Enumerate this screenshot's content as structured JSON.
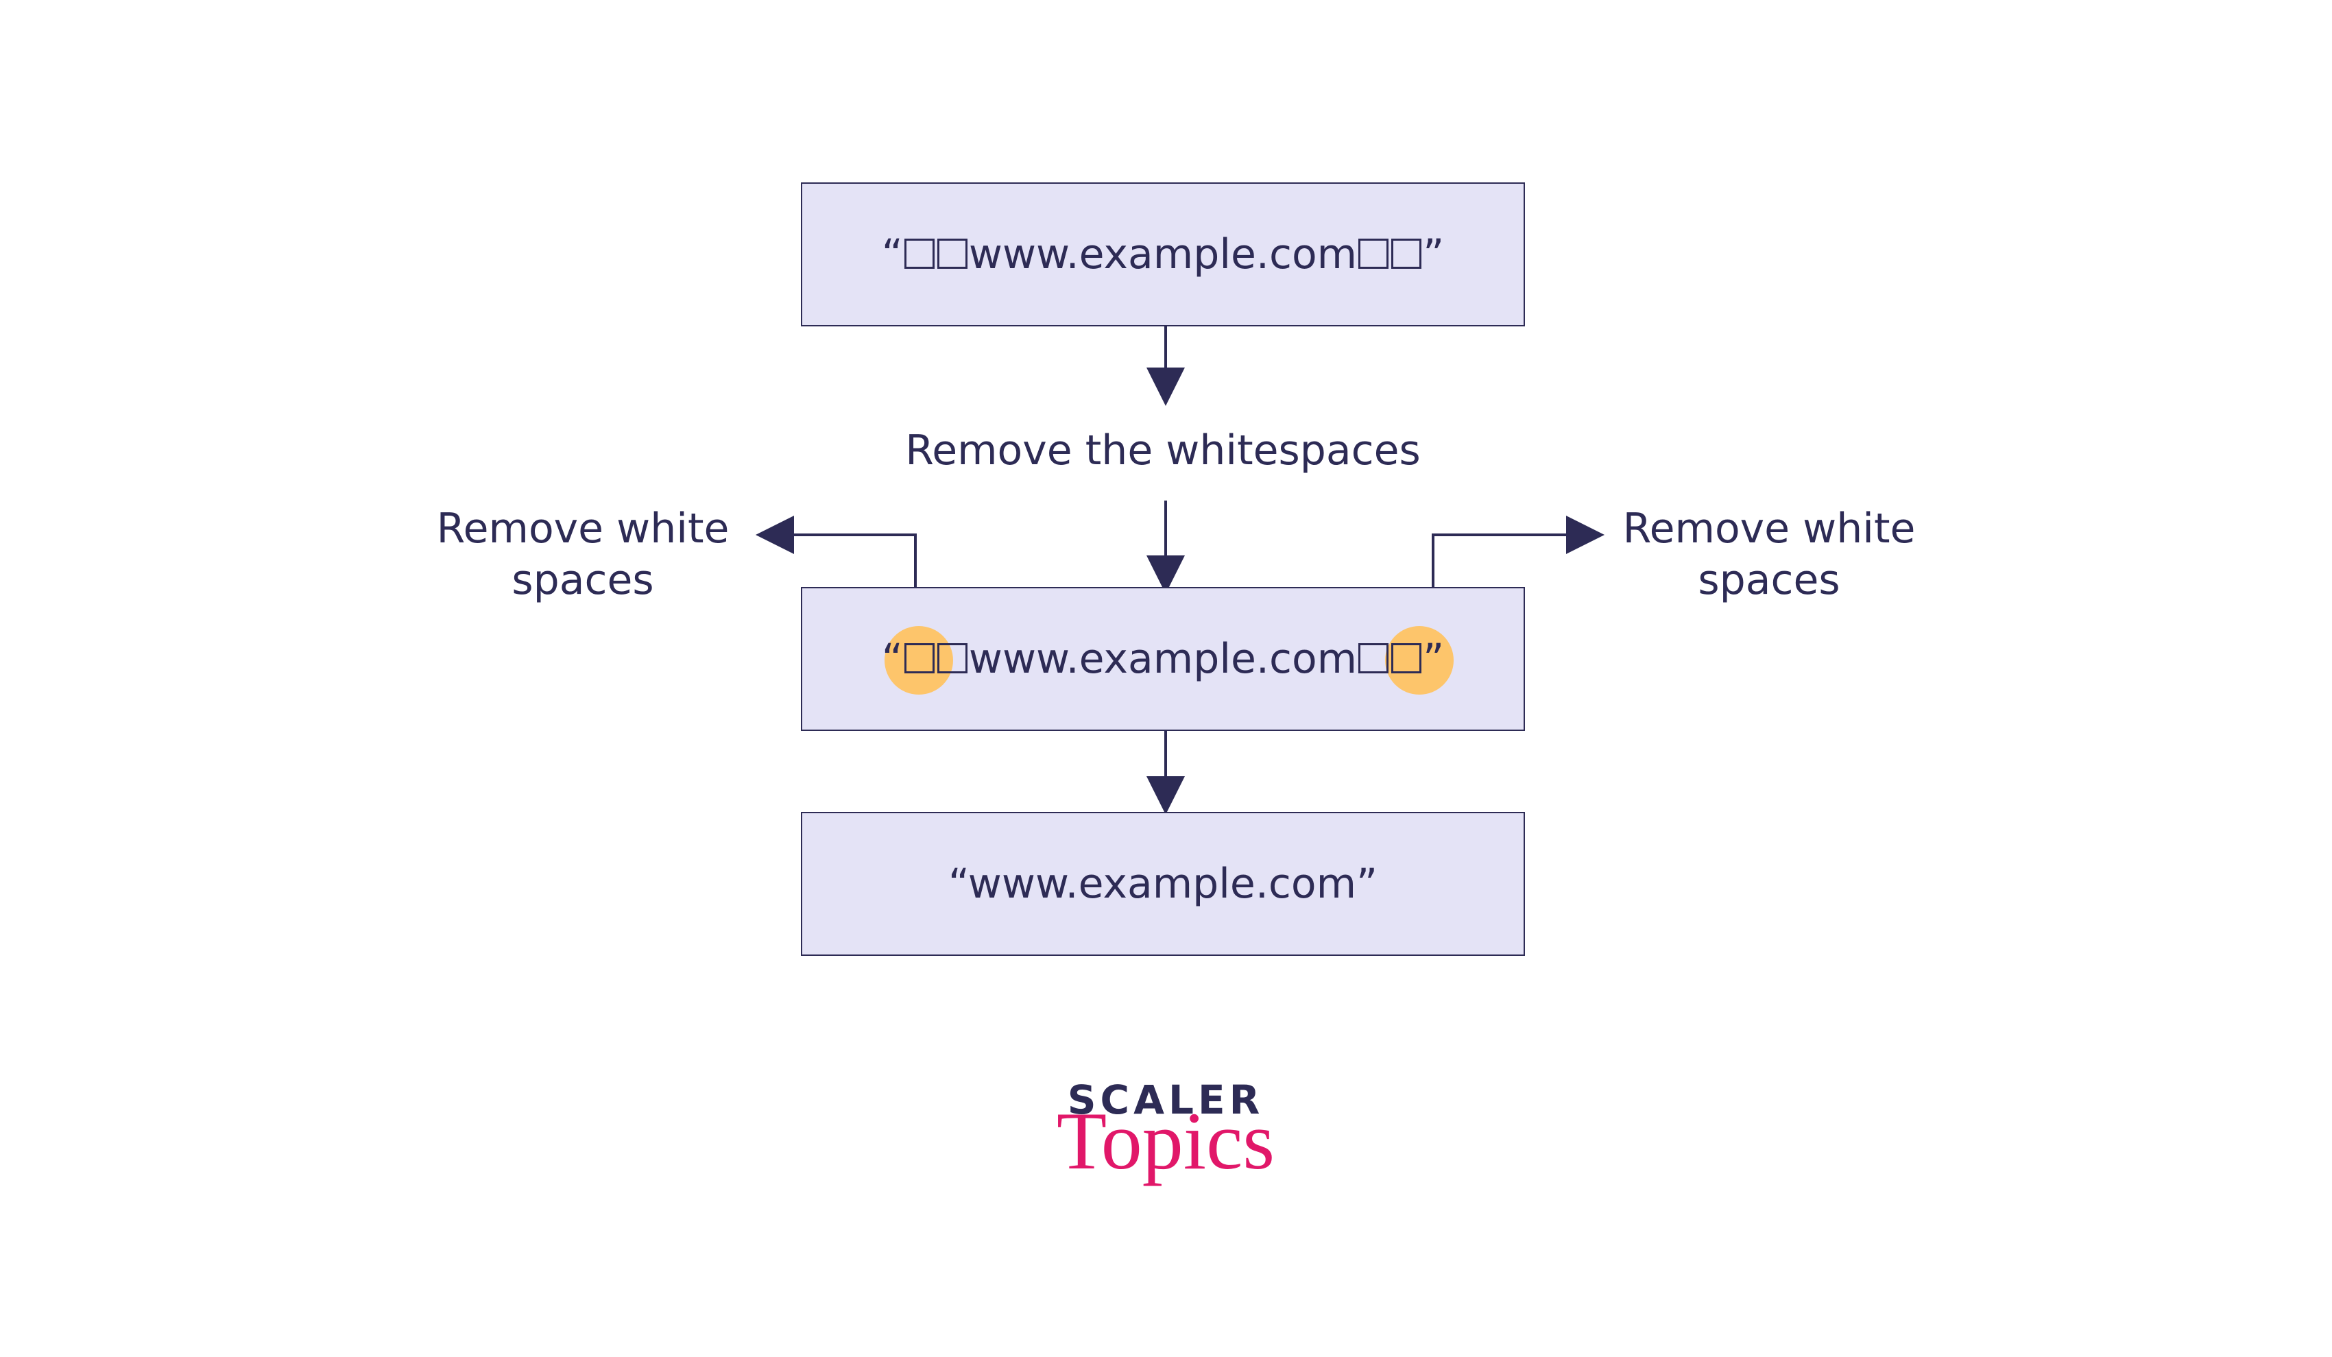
{
  "diagram": {
    "step_label": "Remove the whitespaces",
    "side_label_left": "Remove white\nspaces",
    "side_label_right": "Remove white\nspaces",
    "url_text": "www.example.com",
    "box3_text": "“www.example.com”",
    "colors": {
      "box_fill": "#e4e3f6",
      "box_border": "#2d2b55",
      "text": "#2d2b55",
      "highlight": "#fdc56b",
      "logo_accent": "#e11769"
    },
    "whitespace_count_per_side": 2
  },
  "logo": {
    "line1": "SCALER",
    "line2": "Topics"
  }
}
